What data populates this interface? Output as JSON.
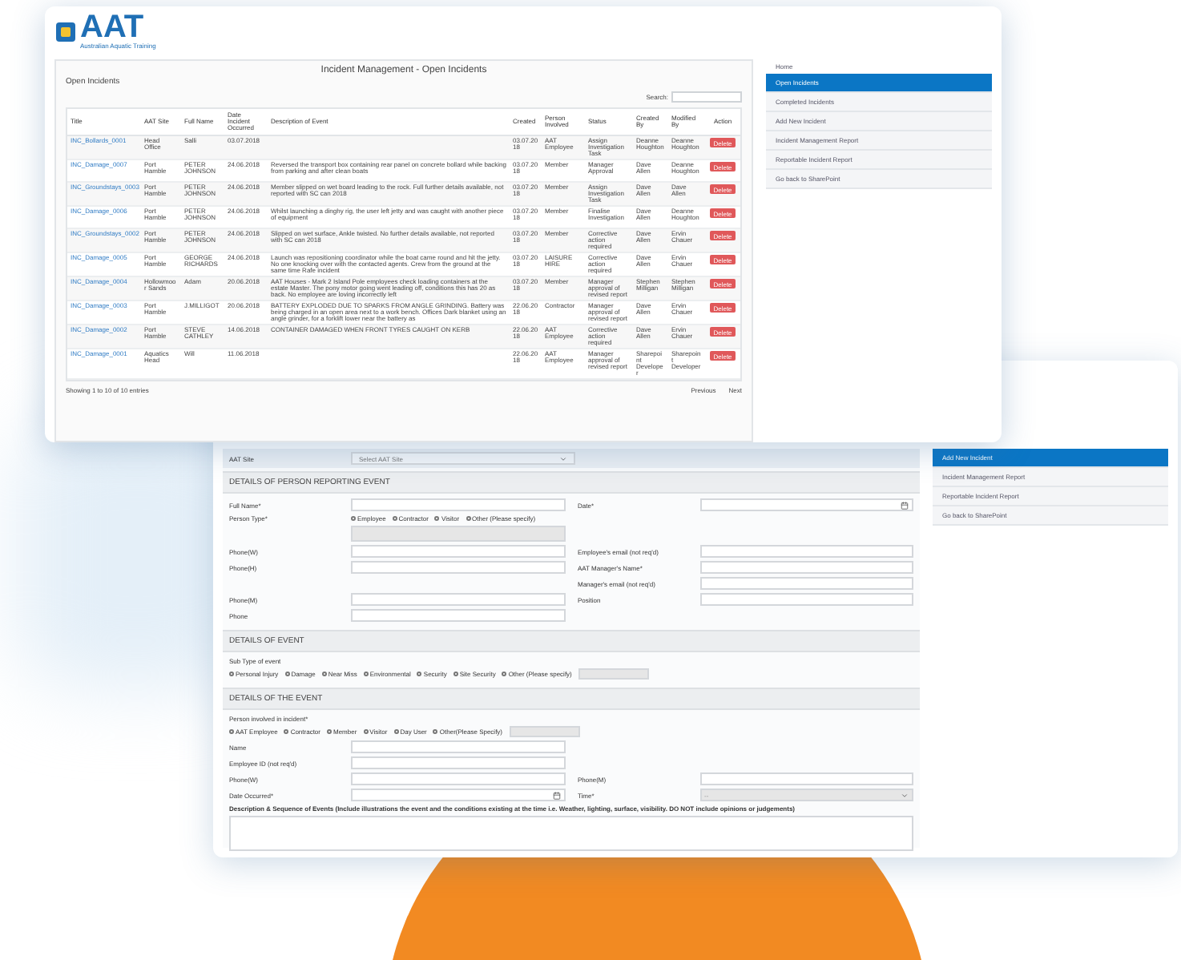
{
  "logo": {
    "text": "AAT",
    "tagline": "Australian Aquatic Training"
  },
  "incidents_window": {
    "title": "Incident Management - Open Incidents",
    "subtitle": "Open Incidents",
    "search_label": "Search:",
    "columns": [
      "Title",
      "AAT Site",
      "Full Name",
      "Date Incident Occurred",
      "Description of Event",
      "Created",
      "Person Involved",
      "Status",
      "Created By",
      "Modified By",
      "Action"
    ],
    "rows": [
      {
        "cells": [
          "INC_Bollards_0001",
          "Head Office",
          "Salli",
          "03.07.2018",
          "",
          "03.07.2018",
          "AAT Employee",
          "Assign Investigation Task",
          "Deanne Houghton",
          "Deanne Houghton"
        ],
        "action": "Delete"
      },
      {
        "cells": [
          "INC_Damage_0007",
          "Port Hamble",
          "PETER JOHNSON",
          "24.06.2018",
          "Reversed the transport box containing rear panel on concrete bollard while backing from parking and after clean boats",
          "03.07.2018",
          "Member",
          "Manager Approval",
          "Dave Allen",
          "Deanne Houghton"
        ],
        "action": "Delete"
      },
      {
        "cells": [
          "INC_Groundstays_0003",
          "Port Hamble",
          "PETER JOHNSON",
          "24.06.2018",
          "Member slipped on wet board leading to the rock. Full further details available, not reported with SC can 2018",
          "03.07.2018",
          "Member",
          "Assign Investigation Task",
          "Dave Allen",
          "Dave Allen"
        ],
        "action": "Delete"
      },
      {
        "cells": [
          "INC_Damage_0006",
          "Port Hamble",
          "PETER JOHNSON",
          "24.06.2018",
          "Whilst launching a dinghy rig, the user left jetty and was caught with another piece of equipment",
          "03.07.2018",
          "Member",
          "Finalise Investigation",
          "Dave Allen",
          "Deanne Houghton"
        ],
        "action": "Delete"
      },
      {
        "cells": [
          "INC_Groundstays_0002",
          "Port Hamble",
          "PETER JOHNSON",
          "24.06.2018",
          "Slipped on wet surface, Ankle twisted. No further details available, not reported with SC can 2018",
          "03.07.2018",
          "Member",
          "Corrective action required",
          "Dave Allen",
          "Ervin Chauer"
        ],
        "action": "Delete"
      },
      {
        "cells": [
          "INC_Damage_0005",
          "Port Hamble",
          "GEORGE RICHARDS",
          "24.06.2018",
          "Launch was repositioning coordinator while the boat came round and hit the jetty. No one knocking over with the contacted agents. Crew from the ground at the same time Rafe incident",
          "03.07.2018",
          "LAISURE HIRE",
          "Corrective action required",
          "Dave Allen",
          "Ervin Chauer"
        ],
        "action": "Delete"
      },
      {
        "cells": [
          "INC_Damage_0004",
          "Hollowmoor Sands",
          "Adam",
          "20.06.2018",
          "AAT Houses - Mark 2 Island Pole employees check loading containers at the estate Master. The pony motor going went leading off, conditions this has 20 as back. No employee are loving incorrectly left",
          "03.07.2018",
          "Member",
          "Manager approval of revised report",
          "Stephen Milligan",
          "Stephen Milligan"
        ],
        "action": "Delete"
      },
      {
        "cells": [
          "INC_Damage_0003",
          "Port Hamble",
          "J.MILLIGOT",
          "20.06.2018",
          "BATTERY EXPLODED DUE TO SPARKS FROM ANGLE GRINDING. Battery was being charged in an open area next to a work bench. Offices Dark blanket using an angle grinder, for a forklift lower near the battery as",
          "22.06.2018",
          "Contractor",
          "Manager approval of revised report",
          "Dave Allen",
          "Ervin Chauer"
        ],
        "action": "Delete"
      },
      {
        "cells": [
          "INC_Damage_0002",
          "Port Hamble",
          "STEVE CATHLEY",
          "14.06.2018",
          "CONTAINER DAMAGED WHEN FRONT TYRES CAUGHT ON KERB",
          "22.06.2018",
          "AAT Employee",
          "Corrective action required",
          "Dave Allen",
          "Ervin Chauer"
        ],
        "action": "Delete"
      },
      {
        "cells": [
          "INC_Damage_0001",
          "Aquatics Head",
          "Will",
          "11.06.2018",
          "",
          "22.06.2018",
          "AAT Employee",
          "Manager approval of revised report",
          "Sharepoint Developer",
          "Sharepoint Developer"
        ],
        "action": "Delete"
      }
    ],
    "footer": "Showing 1 to 10 of 10 entries",
    "pager": [
      "Previous",
      "Next"
    ],
    "home_link": "Home",
    "sidebar": [
      {
        "label": "Open Incidents",
        "selected": true
      },
      {
        "label": "Completed Incidents",
        "selected": false
      },
      {
        "label": "Add New Incident",
        "selected": false
      },
      {
        "label": "Incident Management Report",
        "selected": false
      },
      {
        "label": "Reportable Incident Report",
        "selected": false
      },
      {
        "label": "Go back to SharePoint",
        "selected": false
      }
    ]
  },
  "form_window": {
    "site": {
      "label": "AAT Site",
      "placeholder": "Select AAT Site"
    },
    "sections": [
      {
        "title": "DETAILS OF PERSON REPORTING EVENT",
        "items": [
          {
            "kind": "pair",
            "left": {
              "label": "Full Name*"
            },
            "right": {
              "label": "Date*",
              "kind": "date"
            }
          },
          {
            "kind": "radio-row",
            "label": "Person Type*",
            "options": [
              {
                "label": "Employee",
                "selected": false
              },
              {
                "label": "Contractor",
                "selected": false
              },
              {
                "label": "Visitor",
                "selected": false
              },
              {
                "label": "Other (Please specify)",
                "selected": false
              }
            ],
            "has_other_field": true
          },
          {
            "kind": "pair",
            "left": {
              "label": "Phone(W)"
            },
            "right": {
              "label": "Employee's email (not req'd)"
            }
          },
          {
            "kind": "pair",
            "left": {
              "label": "Phone(H)"
            },
            "right": {
              "label": "AAT Manager's Name*"
            }
          },
          {
            "kind": "pair",
            "right": {
              "label": "Manager's email (not req'd)"
            }
          },
          {
            "kind": "pair",
            "left": {
              "label": "Phone(M)"
            },
            "right": {
              "label": "Position"
            }
          },
          {
            "kind": "pair",
            "left": {
              "label": "Phone"
            }
          }
        ]
      },
      {
        "title": "DETAILS OF EVENT",
        "items": [
          {
            "kind": "text",
            "text": "Sub Type of event"
          },
          {
            "kind": "radio-block",
            "options": [
              {
                "label": "Personal Injury",
                "selected": false
              },
              {
                "label": "Damage",
                "selected": false
              },
              {
                "label": "Near Miss",
                "selected": false
              },
              {
                "label": "Environmental",
                "selected": false
              },
              {
                "label": "Security",
                "selected": false
              },
              {
                "label": "Site Security",
                "selected": false
              },
              {
                "label": "Other (Please specify)",
                "selected": false
              }
            ],
            "has_other_field": true
          }
        ]
      },
      {
        "title": "DETAILS OF THE EVENT",
        "items": [
          {
            "kind": "text",
            "text": "Person involved in incident*"
          },
          {
            "kind": "radio-block",
            "options": [
              {
                "label": "AAT Employee",
                "selected": false
              },
              {
                "label": "Contractor",
                "selected": false
              },
              {
                "label": "Member",
                "selected": false
              },
              {
                "label": "Visitor",
                "selected": false
              },
              {
                "label": "Day User",
                "selected": false
              },
              {
                "label": "Other(Please Specify)",
                "selected": false
              }
            ],
            "has_other_field": true
          },
          {
            "kind": "pair",
            "left": {
              "label": "Name"
            }
          },
          {
            "kind": "pair",
            "left": {
              "label": "Employee ID (not req'd)"
            }
          },
          {
            "kind": "pair",
            "left": {
              "label": "Phone(W)"
            },
            "right": {
              "label": "Phone(M)"
            }
          },
          {
            "kind": "pair",
            "left": {
              "label": "Date Occurred*",
              "kind": "date"
            },
            "right": {
              "label": "Time*",
              "kind": "select",
              "value": "--",
              "disabled": true
            }
          },
          {
            "kind": "textarea",
            "label": "Description & Sequence of Events (Include illustrations the event and the conditions existing at the time i.e. Weather, lighting, surface, visibility. DO NOT include opinions or judgements)"
          }
        ]
      }
    ],
    "sidebar": [
      {
        "label": "Add New Incident",
        "selected": true
      },
      {
        "label": "Incident Management Report",
        "selected": false
      },
      {
        "label": "Reportable Incident Report",
        "selected": false
      },
      {
        "label": "Go back to SharePoint",
        "selected": false
      }
    ]
  }
}
